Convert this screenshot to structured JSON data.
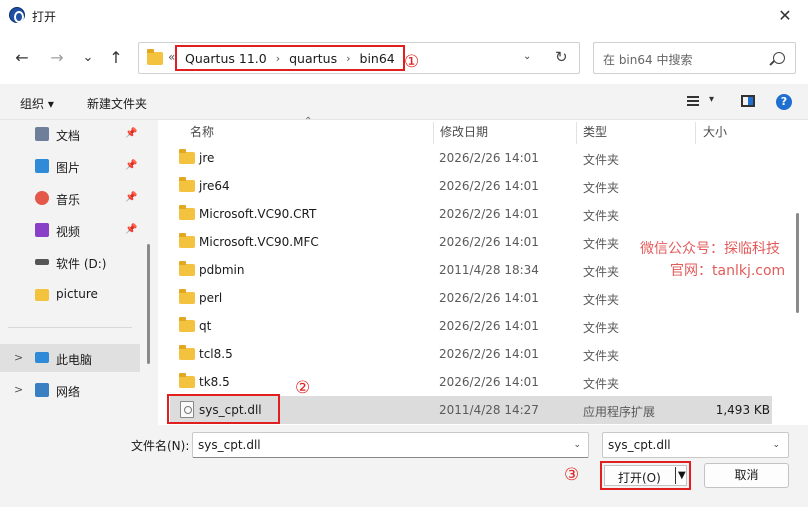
{
  "window": {
    "title": "打开",
    "close_glyph": "✕"
  },
  "nav": {
    "back_glyph": "←",
    "forward_glyph": "→",
    "recent_glyph": "⌄",
    "up_glyph": "↑"
  },
  "address": {
    "more_glyph": "«",
    "crumbs": [
      "Quartus 11.0",
      "quartus",
      "bin64"
    ],
    "separator": "›",
    "dropdown_glyph": "⌄",
    "refresh_glyph": "↻"
  },
  "search": {
    "placeholder": "在 bin64 中搜索"
  },
  "toolbar": {
    "organize": "组织 ▾",
    "new_folder": "新建文件夹",
    "view_arrow": "▾",
    "help_glyph": "?"
  },
  "sidebar": {
    "items": [
      {
        "label": "文档",
        "icon": "document-icon",
        "pinned": true,
        "chevron": ""
      },
      {
        "label": "图片",
        "icon": "pictures-icon",
        "pinned": true,
        "chevron": ""
      },
      {
        "label": "音乐",
        "icon": "music-icon",
        "pinned": true,
        "chevron": ""
      },
      {
        "label": "视频",
        "icon": "video-icon",
        "pinned": true,
        "chevron": ""
      },
      {
        "label": "软件 (D:)",
        "icon": "drive-icon",
        "pinned": false,
        "chevron": ""
      },
      {
        "label": "picture",
        "icon": "folder-icon",
        "pinned": false,
        "chevron": ""
      },
      {
        "label": "此电脑",
        "icon": "computer-icon",
        "pinned": false,
        "chevron": ">"
      },
      {
        "label": "网络",
        "icon": "network-icon",
        "pinned": false,
        "chevron": ">"
      }
    ],
    "pin_glyph": "📌"
  },
  "columns": {
    "name": "名称",
    "date": "修改日期",
    "type": "类型",
    "size": "大小",
    "sort_glyph": "⌃"
  },
  "files": [
    {
      "name": "jre",
      "date": "2026/2/26 14:01",
      "type": "文件夹",
      "size": "",
      "kind": "folder"
    },
    {
      "name": "jre64",
      "date": "2026/2/26 14:01",
      "type": "文件夹",
      "size": "",
      "kind": "folder"
    },
    {
      "name": "Microsoft.VC90.CRT",
      "date": "2026/2/26 14:01",
      "type": "文件夹",
      "size": "",
      "kind": "folder"
    },
    {
      "name": "Microsoft.VC90.MFC",
      "date": "2026/2/26 14:01",
      "type": "文件夹",
      "size": "",
      "kind": "folder"
    },
    {
      "name": "pdbmin",
      "date": "2011/4/28 18:34",
      "type": "文件夹",
      "size": "",
      "kind": "folder"
    },
    {
      "name": "perl",
      "date": "2026/2/26 14:01",
      "type": "文件夹",
      "size": "",
      "kind": "folder"
    },
    {
      "name": "qt",
      "date": "2026/2/26 14:01",
      "type": "文件夹",
      "size": "",
      "kind": "folder"
    },
    {
      "name": "tcl8.5",
      "date": "2026/2/26 14:01",
      "type": "文件夹",
      "size": "",
      "kind": "folder"
    },
    {
      "name": "tk8.5",
      "date": "2026/2/26 14:01",
      "type": "文件夹",
      "size": "",
      "kind": "folder"
    },
    {
      "name": "sys_cpt.dll",
      "date": "2011/4/28 14:27",
      "type": "应用程序扩展",
      "size": "1,493 KB",
      "kind": "file",
      "selected": true
    }
  ],
  "watermark": {
    "line1": "微信公众号：探临科技",
    "line2": "官网：tanlkj.com"
  },
  "markers": {
    "one": "①",
    "two": "②",
    "three": "③"
  },
  "bottom": {
    "filename_label": "文件名(N):",
    "filename_value": "sys_cpt.dll",
    "filetype_value": "sys_cpt.dll",
    "dropdown_glyph": "⌄",
    "open_label": "打开(O)",
    "open_arrow": "▼",
    "cancel_label": "取消"
  },
  "colors": {
    "accent": "#1f6fd1",
    "annotation": "#e02020",
    "folder": "#f3c23e"
  }
}
